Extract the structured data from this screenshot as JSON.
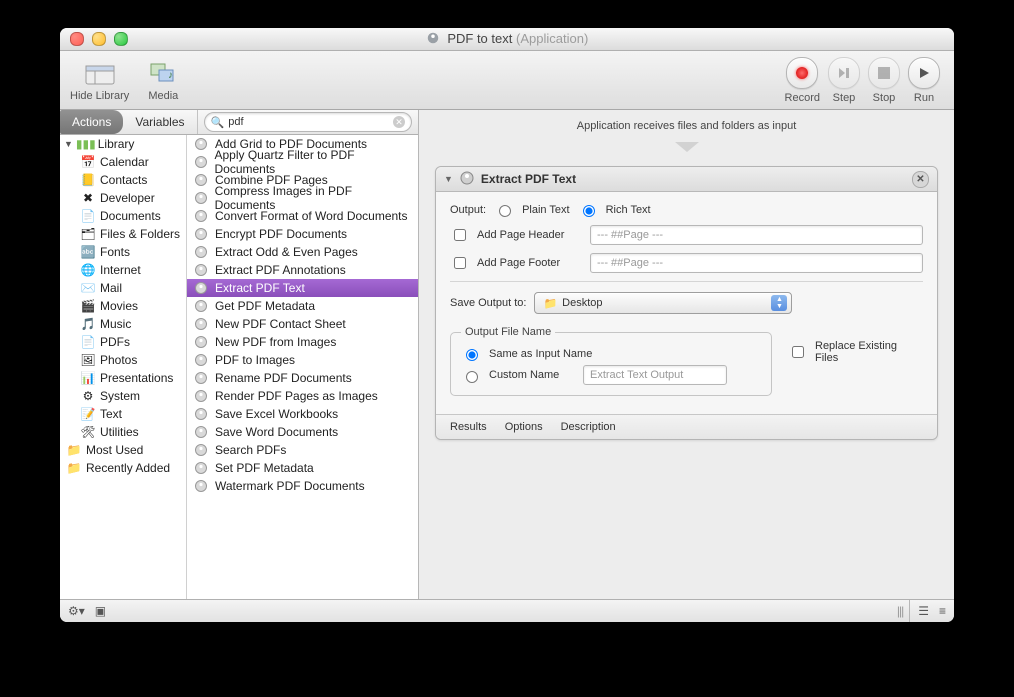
{
  "title": {
    "name": "PDF to text",
    "kind": "Application"
  },
  "toolbar": {
    "hideLibrary": "Hide Library",
    "media": "Media",
    "record": "Record",
    "step": "Step",
    "stop": "Stop",
    "run": "Run"
  },
  "tabs": {
    "actions": "Actions",
    "variables": "Variables"
  },
  "search": {
    "value": "pdf"
  },
  "library": {
    "header": "Library",
    "items": [
      {
        "label": "Calendar",
        "icon": "📅"
      },
      {
        "label": "Contacts",
        "icon": "📒"
      },
      {
        "label": "Developer",
        "icon": "✖︎"
      },
      {
        "label": "Documents",
        "icon": "📄"
      },
      {
        "label": "Files & Folders",
        "icon": "🗂"
      },
      {
        "label": "Fonts",
        "icon": "🔤"
      },
      {
        "label": "Internet",
        "icon": "🌐"
      },
      {
        "label": "Mail",
        "icon": "✉️"
      },
      {
        "label": "Movies",
        "icon": "🎬"
      },
      {
        "label": "Music",
        "icon": "🎵"
      },
      {
        "label": "PDFs",
        "icon": "📄"
      },
      {
        "label": "Photos",
        "icon": "🖼"
      },
      {
        "label": "Presentations",
        "icon": "📊"
      },
      {
        "label": "System",
        "icon": "⚙︎"
      },
      {
        "label": "Text",
        "icon": "📝"
      },
      {
        "label": "Utilities",
        "icon": "🛠"
      }
    ],
    "groups": [
      {
        "label": "Most Used"
      },
      {
        "label": "Recently Added"
      }
    ]
  },
  "actions": [
    "Add Grid to PDF Documents",
    "Apply Quartz Filter to PDF Documents",
    "Combine PDF Pages",
    "Compress Images in PDF Documents",
    "Convert Format of Word Documents",
    "Encrypt PDF Documents",
    "Extract Odd & Even Pages",
    "Extract PDF Annotations",
    "Extract PDF Text",
    "Get PDF Metadata",
    "New PDF Contact Sheet",
    "New PDF from Images",
    "PDF to Images",
    "Rename PDF Documents",
    "Render PDF Pages as Images",
    "Save Excel Workbooks",
    "Save Word Documents",
    "Search PDFs",
    "Set PDF Metadata",
    "Watermark PDF Documents"
  ],
  "actions_selected_index": 8,
  "workflow": {
    "input_desc": "Application receives files and folders as input",
    "step_title": "Extract PDF Text",
    "output_label": "Output:",
    "plain": "Plain Text",
    "rich": "Rich Text",
    "add_header": "Add Page Header",
    "add_footer": "Add Page Footer",
    "page_placeholder": "--- ##Page ---",
    "save_label": "Save Output to:",
    "save_value": "Desktop",
    "ofn_legend": "Output File Name",
    "same_name": "Same as Input Name",
    "custom_name": "Custom Name",
    "custom_placeholder": "Extract Text Output",
    "replace": "Replace Existing Files",
    "footer": {
      "results": "Results",
      "options": "Options",
      "description": "Description"
    }
  }
}
